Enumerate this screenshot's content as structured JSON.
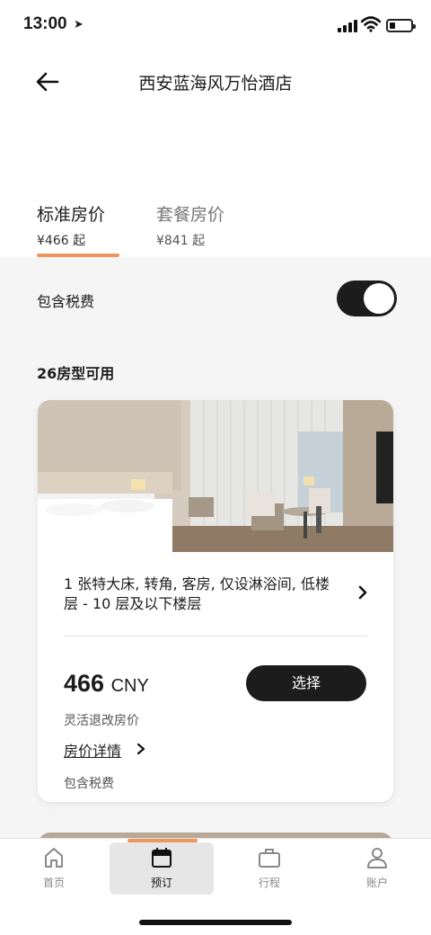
{
  "status": {
    "time": "13:00"
  },
  "header": {
    "title": "西安蓝海风万怡酒店"
  },
  "tabs": [
    {
      "label": "标准房价",
      "price": "¥466 起"
    },
    {
      "label": "套餐房价",
      "price": "¥841 起"
    }
  ],
  "tax": {
    "label": "包含税费",
    "enabled": true
  },
  "rooms_count": "26房型可用",
  "room": {
    "description": "1 张特大床, 转角, 客房, 仅设淋浴间, 低楼层 - 10 层及以下楼层",
    "price": "466",
    "currency": "CNY",
    "select_label": "选择",
    "refund_label": "灵活退改房价",
    "details_label": "房价详情",
    "tax_note": "包含税费"
  },
  "tabbar": [
    {
      "label": "首页",
      "icon": "home-icon",
      "active": false
    },
    {
      "label": "预订",
      "icon": "calendar-icon",
      "active": true
    },
    {
      "label": "行程",
      "icon": "briefcase-icon",
      "active": false
    },
    {
      "label": "账户",
      "icon": "person-icon",
      "active": false
    }
  ],
  "colors": {
    "accent": "#f0955b",
    "dark": "#1c1c1c"
  }
}
